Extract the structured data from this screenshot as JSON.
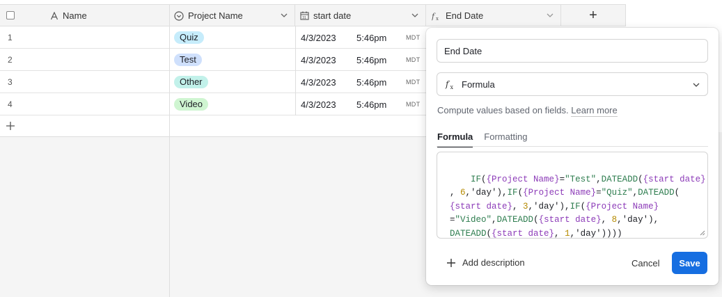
{
  "table": {
    "columns": [
      {
        "label": "Name",
        "icon": "text-icon"
      },
      {
        "label": "Project Name",
        "icon": "single-select-icon"
      },
      {
        "label": "start date",
        "icon": "calendar-icon"
      },
      {
        "label": "End Date",
        "icon": "formula-icon"
      }
    ],
    "add_column_label": "+",
    "rows": [
      {
        "num": "1",
        "project": "Quiz",
        "project_color": "#c6ecfb",
        "date": "4/3/2023",
        "time": "5:46pm",
        "tz": "MDT"
      },
      {
        "num": "2",
        "project": "Test",
        "project_color": "#cfe0fc",
        "date": "4/3/2023",
        "time": "5:46pm",
        "tz": "MDT"
      },
      {
        "num": "3",
        "project": "Other",
        "project_color": "#c2f1ea",
        "date": "4/3/2023",
        "time": "5:46pm",
        "tz": "MDT"
      },
      {
        "num": "4",
        "project": "Video",
        "project_color": "#cff5d1",
        "date": "4/3/2023",
        "time": "5:46pm",
        "tz": "MDT"
      }
    ]
  },
  "panel": {
    "field_name_value": "End Date",
    "field_type": "Formula",
    "hint_text": "Compute values based on fields.",
    "learn_more": "Learn more",
    "tabs": [
      "Formula",
      "Formatting"
    ],
    "formula": "IF({Project Name}=\"Test\",DATEADD({start date}\n, 6,'day'),IF({Project Name}=\"Quiz\",DATEADD(\n{start date}, 3,'day'),IF({Project Name}\n=\"Video\",DATEADD({start date}, 8,'day'),\nDATEADD({start date}, 1,'day'))))",
    "add_description": "Add description",
    "cancel": "Cancel",
    "save": "Save"
  },
  "colors": {
    "accent": "#166ee1",
    "header_bg": "#f4f4f4",
    "formula_fn": "#2e7d4f",
    "formula_ref": "#8c3bb8",
    "formula_num": "#b58a00"
  }
}
